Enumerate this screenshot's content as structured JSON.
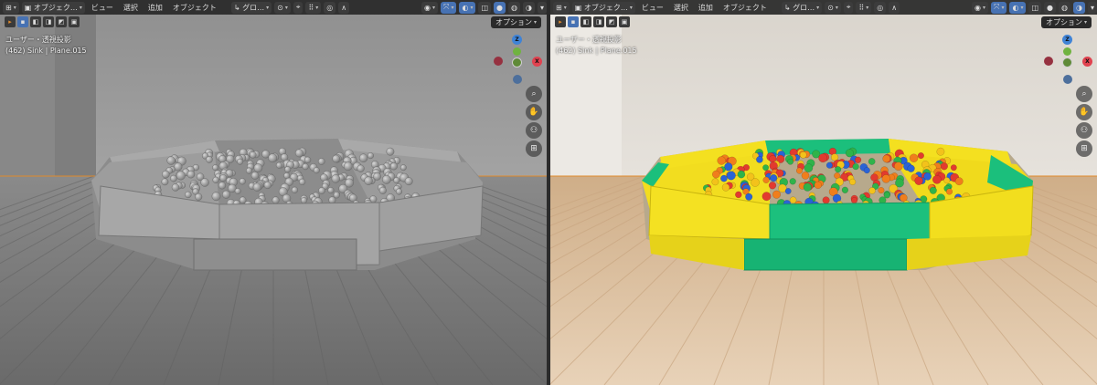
{
  "colors": {
    "header_bg": "#282828",
    "accent": "#4772b3",
    "left_wall": "#9a9a9a",
    "left_floor": "#7a7a7a",
    "right_wall": "#e2ddd6",
    "right_floor": "#dcbc98",
    "pit_yellow": "#f4e020",
    "pit_green": "#1bbf7c",
    "horizon": "#e08a2b",
    "axis_x": "#e0424f",
    "axis_y": "#70b340",
    "axis_z": "#3f83d6"
  },
  "viewports": [
    {
      "id": "left",
      "mode": "solid",
      "header": {
        "mode_label": "オブジェク…",
        "menus": [
          "ビュー",
          "選択",
          "追加",
          "オブジェクト"
        ],
        "orientation_label": "グロ…"
      },
      "options_label": "オプション",
      "view_name": "ユーザー・透視投影",
      "object_info": "(462) Sink | Plane.015"
    },
    {
      "id": "right",
      "mode": "rendered",
      "header": {
        "mode_label": "オブジェク…",
        "menus": [
          "ビュー",
          "選択",
          "追加",
          "オブジェクト"
        ],
        "orientation_label": "グロ…"
      },
      "options_label": "オプション",
      "view_name": "ユーザー・透視投影",
      "object_info": "(462) Sink | Plane.015"
    }
  ],
  "gizmo": {
    "x": "X",
    "y": "Y",
    "z": "Z"
  },
  "icons": [
    "editor-type-icon",
    "object-mode-icon",
    "transform-orientation-icon",
    "pivot-icon",
    "snap-icon",
    "proportional-edit-icon",
    "visibility-icon",
    "gizmo-toggle-icon",
    "overlay-toggle-icon",
    "xray-icon",
    "shading-solid-icon",
    "shading-material-icon",
    "shading-rendered-icon",
    "zoom-icon",
    "pan-icon",
    "camera-icon",
    "grid-icon"
  ]
}
